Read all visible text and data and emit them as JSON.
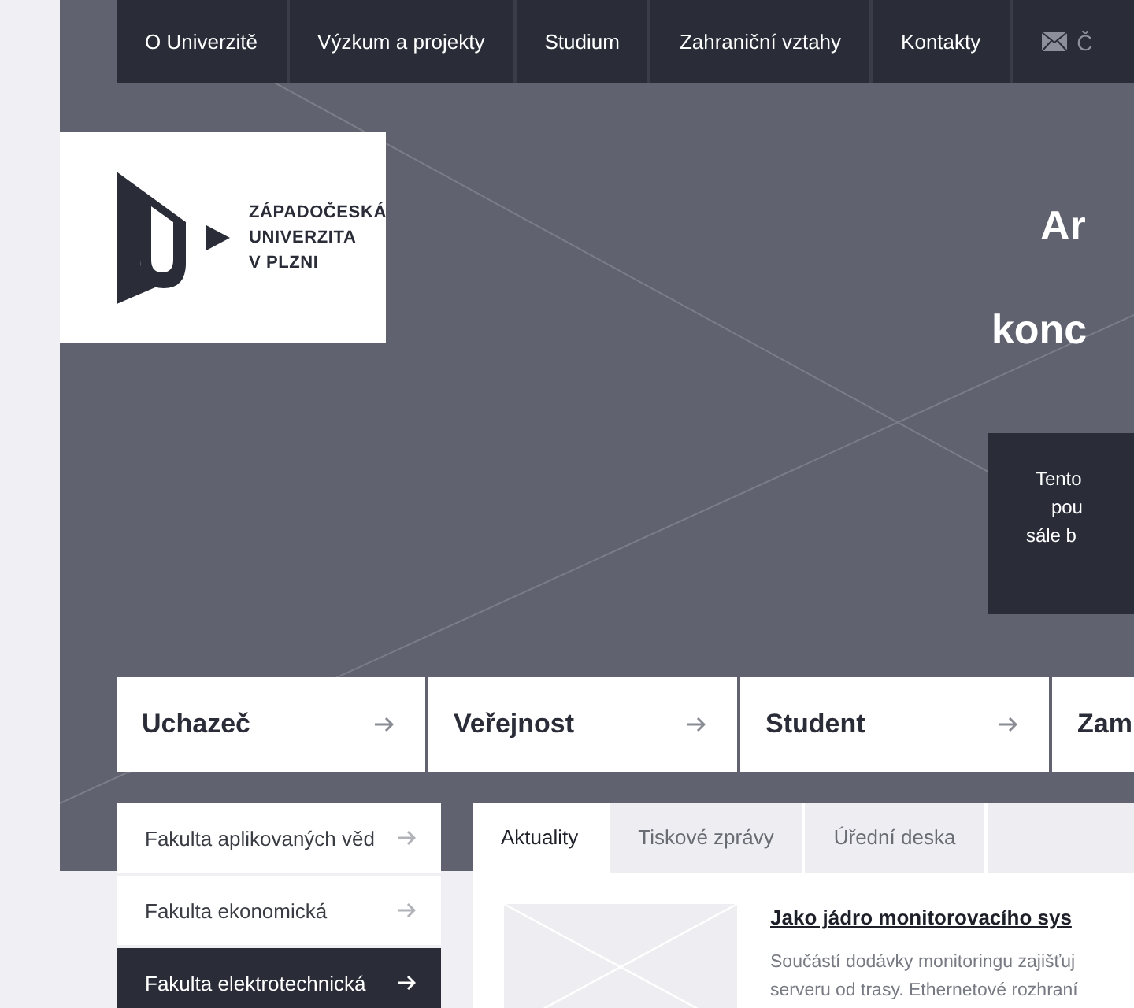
{
  "nav": {
    "items": [
      {
        "label": "O Univerzitě"
      },
      {
        "label": "Výzkum a projekty"
      },
      {
        "label": "Studium"
      },
      {
        "label": "Zahraniční vztahy"
      },
      {
        "label": "Kontakty"
      }
    ],
    "mail_label": "Č"
  },
  "logo": {
    "lines": [
      "ZÁPADOČESKÁ",
      "UNIVERZITA",
      "V PLZNI"
    ]
  },
  "hero": {
    "headings": [
      "Ar",
      "konc"
    ],
    "notice_lines": [
      "Tento",
      "pou",
      "sále b"
    ]
  },
  "audiences": [
    {
      "label": "Uchazeč"
    },
    {
      "label": "Veřejnost"
    },
    {
      "label": "Student"
    },
    {
      "label": "Zam"
    }
  ],
  "faculties": [
    {
      "label": "Fakulta aplikovaných věd",
      "selected": false
    },
    {
      "label": "Fakulta ekonomická",
      "selected": false
    },
    {
      "label": "Fakulta elektrotechnická",
      "selected": true
    }
  ],
  "tabs": [
    {
      "label": "Aktuality",
      "selected": true
    },
    {
      "label": "Tiskové zprávy",
      "selected": false
    },
    {
      "label": "Úřední deska",
      "selected": false
    }
  ],
  "news": {
    "title": "Jako jádro monitorovacího sys",
    "text_lines": [
      "Součástí dodávky monitoringu zajišťuj",
      "serveru od trasy. Ethernetové rozhraní"
    ]
  }
}
